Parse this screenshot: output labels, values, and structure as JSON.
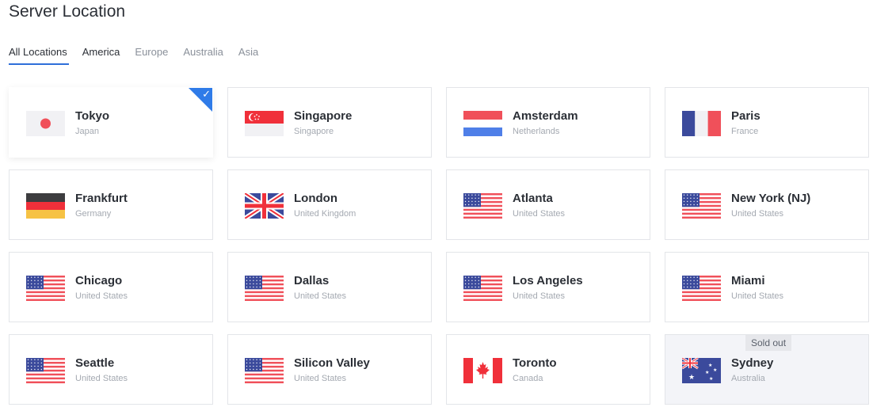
{
  "page": {
    "title": "Server Location"
  },
  "tabs": [
    {
      "label": "All Locations"
    },
    {
      "label": "America"
    },
    {
      "label": "Europe"
    },
    {
      "label": "Australia"
    },
    {
      "label": "Asia"
    }
  ],
  "locations": [
    {
      "city": "Tokyo",
      "country": "Japan",
      "flag_icon": "japan-flag-icon",
      "selected": true
    },
    {
      "city": "Singapore",
      "country": "Singapore",
      "flag_icon": "singapore-flag-icon"
    },
    {
      "city": "Amsterdam",
      "country": "Netherlands",
      "flag_icon": "netherlands-flag-icon"
    },
    {
      "city": "Paris",
      "country": "France",
      "flag_icon": "france-flag-icon"
    },
    {
      "city": "Frankfurt",
      "country": "Germany",
      "flag_icon": "germany-flag-icon"
    },
    {
      "city": "London",
      "country": "United Kingdom",
      "flag_icon": "uk-flag-icon"
    },
    {
      "city": "Atlanta",
      "country": "United States",
      "flag_icon": "us-flag-icon"
    },
    {
      "city": "New York (NJ)",
      "country": "United States",
      "flag_icon": "us-flag-icon"
    },
    {
      "city": "Chicago",
      "country": "United States",
      "flag_icon": "us-flag-icon"
    },
    {
      "city": "Dallas",
      "country": "United States",
      "flag_icon": "us-flag-icon"
    },
    {
      "city": "Los Angeles",
      "country": "United States",
      "flag_icon": "us-flag-icon"
    },
    {
      "city": "Miami",
      "country": "United States",
      "flag_icon": "us-flag-icon"
    },
    {
      "city": "Seattle",
      "country": "United States",
      "flag_icon": "us-flag-icon"
    },
    {
      "city": "Silicon Valley",
      "country": "United States",
      "flag_icon": "us-flag-icon"
    },
    {
      "city": "Toronto",
      "country": "Canada",
      "flag_icon": "canada-flag-icon"
    },
    {
      "city": "Sydney",
      "country": "Australia",
      "flag_icon": "australia-flag-icon",
      "badge": "Sold out"
    }
  ],
  "colors": {
    "accent": "#2f7be8",
    "flag_red": "#f0505a",
    "flag_blue": "#3b4a9c"
  }
}
